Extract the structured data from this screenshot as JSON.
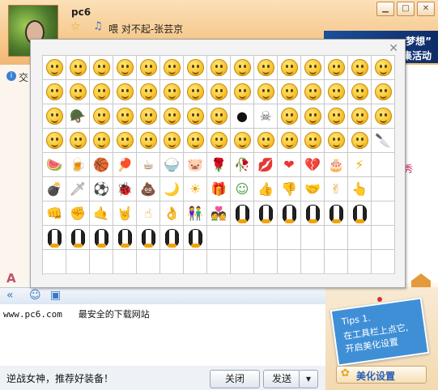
{
  "header": {
    "nickname": "pc6",
    "song": "喂 对不起-张芸京",
    "banner_line1": "梦想”",
    "banner_line2": "集活动",
    "info_text": "交"
  },
  "picker": {
    "columns": 15,
    "rows": 9,
    "faces_count": 67,
    "items": [
      {
        "t": "face"
      },
      {
        "t": "face"
      },
      {
        "t": "face"
      },
      {
        "t": "face"
      },
      {
        "t": "face"
      },
      {
        "t": "face"
      },
      {
        "t": "face"
      },
      {
        "t": "face"
      },
      {
        "t": "face"
      },
      {
        "t": "face"
      },
      {
        "t": "face"
      },
      {
        "t": "face"
      },
      {
        "t": "face"
      },
      {
        "t": "face"
      },
      {
        "t": "face"
      },
      {
        "t": "face"
      },
      {
        "t": "face"
      },
      {
        "t": "face"
      },
      {
        "t": "face"
      },
      {
        "t": "face"
      },
      {
        "t": "face"
      },
      {
        "t": "face"
      },
      {
        "t": "face"
      },
      {
        "t": "face"
      },
      {
        "t": "face"
      },
      {
        "t": "face"
      },
      {
        "t": "face"
      },
      {
        "t": "face"
      },
      {
        "t": "face"
      },
      {
        "t": "face"
      },
      {
        "t": "face"
      },
      {
        "t": "glyph",
        "g": "🪖",
        "c": "#3c7a2a"
      },
      {
        "t": "face"
      },
      {
        "t": "face"
      },
      {
        "t": "face"
      },
      {
        "t": "face"
      },
      {
        "t": "face"
      },
      {
        "t": "face"
      },
      {
        "t": "glyph",
        "g": "●",
        "c": "#111"
      },
      {
        "t": "glyph",
        "g": "☠",
        "c": "#555"
      },
      {
        "t": "face"
      },
      {
        "t": "face"
      },
      {
        "t": "face"
      },
      {
        "t": "face"
      },
      {
        "t": "face"
      },
      {
        "t": "face"
      },
      {
        "t": "face"
      },
      {
        "t": "face"
      },
      {
        "t": "face"
      },
      {
        "t": "face"
      },
      {
        "t": "face"
      },
      {
        "t": "face"
      },
      {
        "t": "face"
      },
      {
        "t": "face"
      },
      {
        "t": "face"
      },
      {
        "t": "face"
      },
      {
        "t": "face"
      },
      {
        "t": "face"
      },
      {
        "t": "face"
      },
      {
        "t": "glyph",
        "g": "🔪",
        "c": "#555"
      },
      {
        "t": "glyph",
        "g": "🍉",
        "c": "#d33"
      },
      {
        "t": "glyph",
        "g": "🍺",
        "c": "#e6a317"
      },
      {
        "t": "glyph",
        "g": "🏀",
        "c": "#e07020"
      },
      {
        "t": "glyph",
        "g": "🏓",
        "c": "#e04020"
      },
      {
        "t": "glyph",
        "g": "☕",
        "c": "#8a5a2a"
      },
      {
        "t": "glyph",
        "g": "🍚",
        "c": "#a06030"
      },
      {
        "t": "glyph",
        "g": "🐷",
        "c": "#f0a0a0"
      },
      {
        "t": "glyph",
        "g": "🌹",
        "c": "#c22"
      },
      {
        "t": "glyph",
        "g": "🥀",
        "c": "#c22"
      },
      {
        "t": "glyph",
        "g": "💋",
        "c": "#d22"
      },
      {
        "t": "glyph",
        "g": "❤",
        "c": "#e33"
      },
      {
        "t": "glyph",
        "g": "💔",
        "c": "#e33"
      },
      {
        "t": "glyph",
        "g": "🎂",
        "c": "#d8862a"
      },
      {
        "t": "glyph",
        "g": "⚡",
        "c": "#e6b000"
      },
      {
        "t": "empty"
      },
      {
        "t": "glyph",
        "g": "💣",
        "c": "#222"
      },
      {
        "t": "glyph",
        "g": "🗡",
        "c": "#777"
      },
      {
        "t": "glyph",
        "g": "⚽",
        "c": "#333"
      },
      {
        "t": "glyph",
        "g": "🐞",
        "c": "#c22"
      },
      {
        "t": "glyph",
        "g": "💩",
        "c": "#a0642a"
      },
      {
        "t": "glyph",
        "g": "🌙",
        "c": "#2b6cc4"
      },
      {
        "t": "glyph",
        "g": "☀",
        "c": "#f0a000"
      },
      {
        "t": "glyph",
        "g": "🎁",
        "c": "#2aa0d8"
      },
      {
        "t": "glyph",
        "g": "☺",
        "c": "#3a9a3a"
      },
      {
        "t": "glyph",
        "g": "👍",
        "c": "#e6a020"
      },
      {
        "t": "glyph",
        "g": "👎",
        "c": "#e6a020"
      },
      {
        "t": "glyph",
        "g": "🤝",
        "c": "#e6a020"
      },
      {
        "t": "glyph",
        "g": "✌",
        "c": "#e6a020"
      },
      {
        "t": "glyph",
        "g": "👆",
        "c": "#e6a020"
      },
      {
        "t": "empty"
      },
      {
        "t": "glyph",
        "g": "👊",
        "c": "#e6a020"
      },
      {
        "t": "glyph",
        "g": "✊",
        "c": "#e6a020"
      },
      {
        "t": "glyph",
        "g": "🤙",
        "c": "#e6a020"
      },
      {
        "t": "glyph",
        "g": "🤘",
        "c": "#e6a020"
      },
      {
        "t": "glyph",
        "g": "☝",
        "c": "#e6a020"
      },
      {
        "t": "glyph",
        "g": "👌",
        "c": "#e6a020"
      },
      {
        "t": "glyph",
        "g": "👫",
        "c": "#c33"
      },
      {
        "t": "glyph",
        "g": "💑",
        "c": "#c33"
      },
      {
        "t": "penguin"
      },
      {
        "t": "penguin"
      },
      {
        "t": "penguin"
      },
      {
        "t": "penguin"
      },
      {
        "t": "penguin"
      },
      {
        "t": "penguin"
      },
      {
        "t": "empty"
      },
      {
        "t": "penguin"
      },
      {
        "t": "penguin"
      },
      {
        "t": "penguin"
      },
      {
        "t": "penguin"
      },
      {
        "t": "penguin"
      },
      {
        "t": "penguin"
      },
      {
        "t": "penguin"
      },
      {
        "t": "empty"
      },
      {
        "t": "empty"
      },
      {
        "t": "empty"
      },
      {
        "t": "empty"
      },
      {
        "t": "empty"
      },
      {
        "t": "empty"
      },
      {
        "t": "empty"
      },
      {
        "t": "empty"
      },
      {
        "t": "empty"
      },
      {
        "t": "empty"
      },
      {
        "t": "empty"
      },
      {
        "t": "empty"
      },
      {
        "t": "empty"
      },
      {
        "t": "empty"
      },
      {
        "t": "empty"
      },
      {
        "t": "empty"
      },
      {
        "t": "empty"
      },
      {
        "t": "empty"
      },
      {
        "t": "empty"
      },
      {
        "t": "empty"
      },
      {
        "t": "empty"
      },
      {
        "t": "empty"
      },
      {
        "t": "empty"
      }
    ]
  },
  "chat": {
    "partial_text": "秀"
  },
  "input": {
    "text": "www.pc6.com   最安全的下载网站"
  },
  "footer": {
    "promo": "逆战女神，推荐好装备！",
    "close_label": "关闭",
    "send_label": "发送",
    "dropdown_glyph": "▾"
  },
  "side": {
    "tip_line1": "Tips 1.",
    "tip_line2": "在工具栏上点它,",
    "tip_line3": "开启美化设置",
    "beautify_label": "美化设置"
  },
  "window": {
    "minimize": "▁",
    "maximize": "□",
    "close": "✕"
  }
}
